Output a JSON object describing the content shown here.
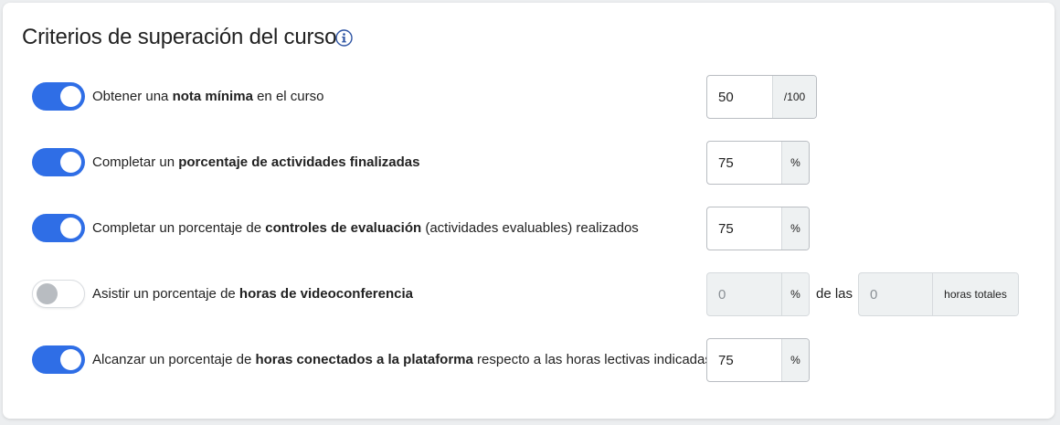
{
  "section": {
    "title": "Criterios de superación del curso",
    "info_icon": "info-icon"
  },
  "criteria": [
    {
      "enabled": true,
      "label_parts": [
        "Obtener una ",
        "nota mínima",
        " en el curso"
      ],
      "value": "50",
      "unit": "/100"
    },
    {
      "enabled": true,
      "label_parts": [
        "Completar un ",
        "porcentaje de actividades finalizadas",
        ""
      ],
      "value": "75",
      "unit": "%"
    },
    {
      "enabled": true,
      "label_parts": [
        "Completar un porcentaje de ",
        "controles de evaluación",
        " (actividades evaluables) realizados"
      ],
      "value": "75",
      "unit": "%"
    },
    {
      "enabled": false,
      "label_parts": [
        "Asistir un porcentaje de ",
        "horas de videoconferencia",
        ""
      ],
      "value": "0",
      "unit": "%",
      "connector": "de las",
      "total_value": "0",
      "total_unit": "horas totales"
    },
    {
      "enabled": true,
      "label_parts": [
        "Alcanzar un porcentaje de ",
        "horas conectados a la plataforma",
        " respecto a las horas lectivas indicadas"
      ],
      "value": "75",
      "unit": "%"
    }
  ],
  "colors": {
    "toggle_on": "#2f6ee6",
    "toggle_off_knob": "#b8bcc1",
    "info_icon": "#2f55a4"
  }
}
